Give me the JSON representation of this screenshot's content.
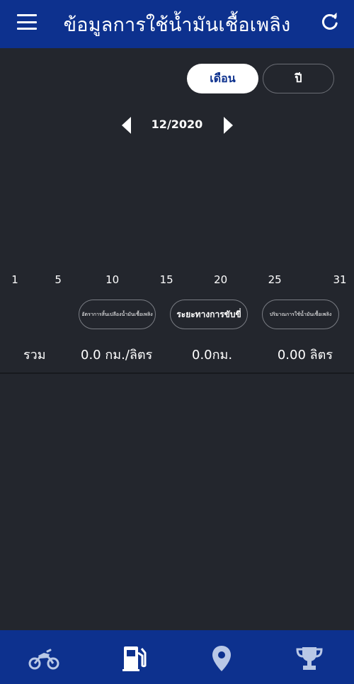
{
  "header": {
    "title": "ข้อมูลการใช้น้ำมันเชื้อเพลิง",
    "menu_icon": "hamburger-menu-icon",
    "refresh_icon": "refresh-icon"
  },
  "period_toggle": {
    "month_label": "เดือน",
    "year_label": "ปี",
    "selected": "month"
  },
  "date_nav": {
    "current": "12/2020",
    "prev_icon": "triangle-left-icon",
    "next_icon": "triangle-right-icon"
  },
  "chart_data": {
    "type": "bar",
    "x_ticks": [
      "1",
      "5",
      "10",
      "15",
      "20",
      "25",
      "31"
    ]
  },
  "metrics": {
    "rate_label": "อัตราการสิ้นเปลืองน้ำมันเชื้อเพลิง",
    "distance_label": "ระยะทางการขับขี่",
    "volume_label": "ปริมาณการใช้น้ำมันเชื้อเพลิง"
  },
  "totals": {
    "label": "รวม",
    "rate": "0.0 กม./ลิตร",
    "distance": "0.0กม.",
    "volume": "0.00 ลิตร"
  },
  "bottom_nav": {
    "items": [
      {
        "icon": "motorcycle-icon"
      },
      {
        "icon": "fuel-pump-icon"
      },
      {
        "icon": "location-pin-icon"
      },
      {
        "icon": "trophy-icon"
      }
    ],
    "icon_color": "#b9c8e6",
    "background": "#0d318e"
  },
  "colors": {
    "background": "#23262d",
    "header": "#0d318e",
    "accent_text": "#0d318e"
  }
}
